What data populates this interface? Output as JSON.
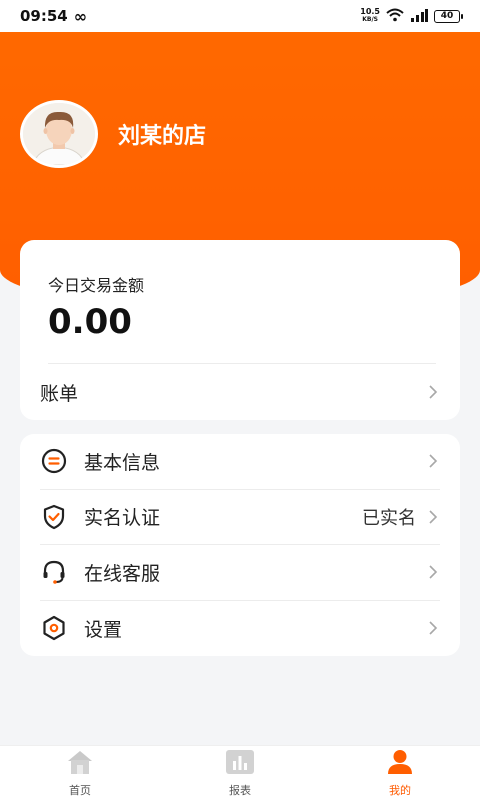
{
  "status_bar": {
    "time": "09:54",
    "net_speed_value": "10.5",
    "net_speed_unit": "KB/S",
    "battery": "40"
  },
  "profile": {
    "shop_name": "刘某的店"
  },
  "trade_card": {
    "label": "今日交易金额",
    "amount": "0.00",
    "bill_label": "账单"
  },
  "menu": {
    "items": [
      {
        "label": "基本信息",
        "value": "",
        "icon": "info-icon"
      },
      {
        "label": "实名认证",
        "value": "已实名",
        "icon": "shield-check-icon"
      },
      {
        "label": "在线客服",
        "value": "",
        "icon": "headset-icon"
      },
      {
        "label": "设置",
        "value": "",
        "icon": "settings-hexagon-icon"
      }
    ]
  },
  "tabbar": {
    "tabs": [
      {
        "label": "首页",
        "icon": "home-icon",
        "active": false
      },
      {
        "label": "报表",
        "icon": "chart-icon",
        "active": false
      },
      {
        "label": "我的",
        "icon": "user-icon",
        "active": true
      }
    ]
  },
  "colors": {
    "accent": "#ff5e00",
    "background": "#f4f5f7"
  }
}
